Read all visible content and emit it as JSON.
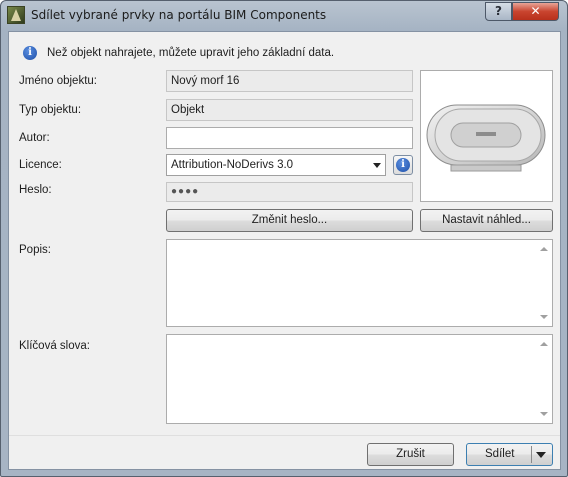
{
  "window": {
    "title": "Sdílet vybrané prvky na portálu BIM Components",
    "help_label": "?",
    "close_label": "✕"
  },
  "info": {
    "icon": "info-icon",
    "message": "Než objekt nahrajete, můžete upravit jeho základní data."
  },
  "form": {
    "name_label": "Jméno objektu:",
    "name_value": "Nový morf 16",
    "type_label": "Typ objektu:",
    "type_value": "Objekt",
    "author_label": "Autor:",
    "author_value": "",
    "license_label": "Licence:",
    "license_value": "Attribution-NoDerivs 3.0",
    "password_label": "Heslo:",
    "password_value": "●●●●",
    "change_password_button": "Změnit heslo...",
    "set_preview_button": "Nastavit náhled...",
    "description_label": "Popis:",
    "description_value": "",
    "keywords_label": "Klíčová slova:",
    "keywords_value": ""
  },
  "footer": {
    "cancel_button": "Zrušit",
    "share_button": "Sdílet"
  }
}
